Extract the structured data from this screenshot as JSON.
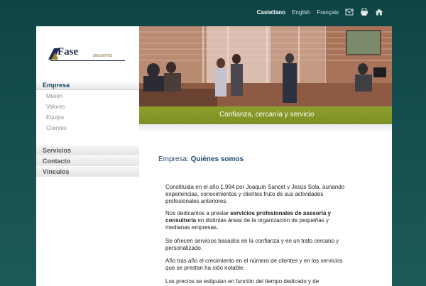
{
  "header": {
    "languages": [
      {
        "label": "Castellano",
        "active": true
      },
      {
        "label": "English",
        "active": false
      },
      {
        "label": "Français",
        "active": false
      }
    ],
    "icons": [
      "mail-icon",
      "print-icon",
      "home-icon"
    ]
  },
  "logo": {
    "name": "Fase",
    "sub": "asesores"
  },
  "sidebar": {
    "sections": [
      {
        "label": "Empresa",
        "active": true,
        "items": [
          "Misión",
          "Valores",
          "Equipo",
          "Clientes"
        ]
      },
      {
        "label": "Servicios",
        "active": false
      },
      {
        "label": "Contacto",
        "active": false
      },
      {
        "label": "Vínculos",
        "active": false
      }
    ]
  },
  "banner": {
    "tagline": "Confianza, cercanía y servicio"
  },
  "content": {
    "section": "Empresa:",
    "title": "Quiénes somos",
    "paragraphs": [
      {
        "text": "Constituida en el año 1.994 por Joaquín Sancet y Jesús Sola, aunando experiencias, conocimientos y clientes fruto de sus actividades profesionales anteriores."
      },
      {
        "pre": "Nos dedicamos a prestar ",
        "bold": "servicios profesionales de asesoría y consultoría",
        "post": " en distintas áreas de la organización de pequeñas y medianas empresas."
      },
      {
        "text": "Se ofrecen servicios basados en la confianza y en un trato cercano y personalizado."
      },
      {
        "text": "Año tras año el crecimiento en el número de clientes y en los servicios que se prestan ha sido notable."
      },
      {
        "text": "Los precios se estipulan en función del tiempo dedicado y de"
      }
    ]
  }
}
